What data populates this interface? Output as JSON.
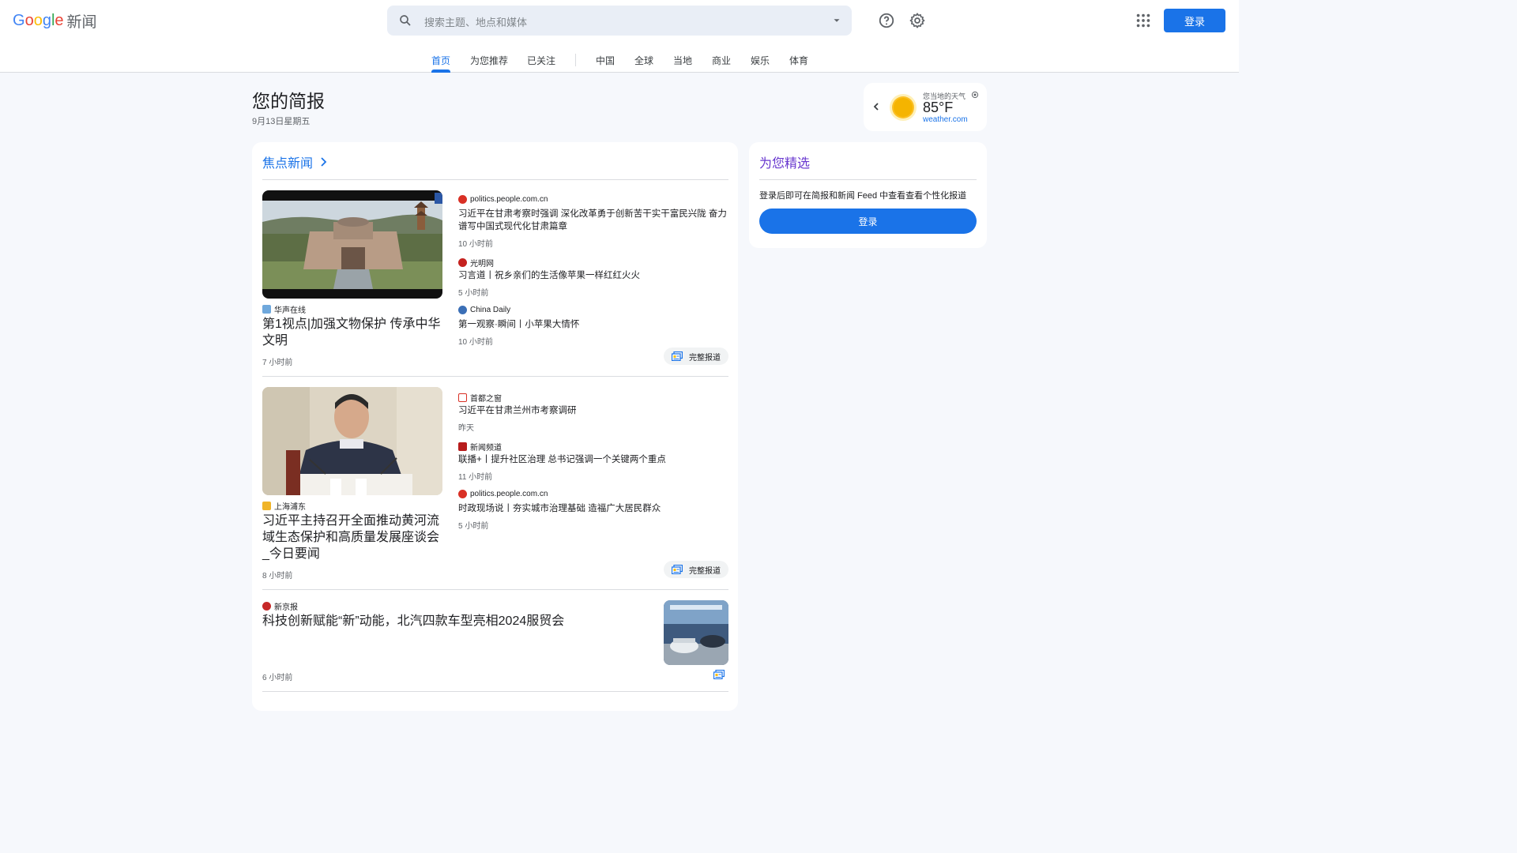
{
  "header": {
    "logo_letters": [
      "G",
      "o",
      "o",
      "g",
      "l",
      "e"
    ],
    "logo_colors": [
      "#4285f4",
      "#ea4335",
      "#fbbc05",
      "#4285f4",
      "#34a853",
      "#ea4335"
    ],
    "product": "新闻",
    "search_placeholder": "搜索主题、地点和媒体",
    "signin": "登录"
  },
  "nav": {
    "tabs": [
      "首页",
      "为您推荐",
      "已关注",
      "中国",
      "全球",
      "当地",
      "商业",
      "娱乐",
      "体育"
    ],
    "active": "首页"
  },
  "briefing": {
    "title": "您的简报",
    "date": "9月13日星期五"
  },
  "weather": {
    "label": "您当地的天气",
    "temp": "85°F",
    "source": "weather.com"
  },
  "top_stories": {
    "title": "焦点新闻",
    "full_coverage": "完整报道",
    "clusters": [
      {
        "main": {
          "source": "华声在线",
          "title": "第1视点|加强文物保护 传承中华文明",
          "time": "7 小时前"
        },
        "related": [
          {
            "source": "politics.people.com.cn",
            "title": "习近平在甘肃考察时强调 深化改革勇于创新苦干实干富民兴陇 奋力谱写中国式现代化甘肃篇章",
            "time": "10 小时前"
          },
          {
            "source": "光明网",
            "title": "习言道丨祝乡亲们的生活像苹果一样红红火火",
            "time": "5 小时前"
          },
          {
            "source": "China Daily",
            "title": "第一观察·瞬间丨小苹果大情怀",
            "time": "10 小时前"
          }
        ]
      },
      {
        "main": {
          "source": "上海浦东",
          "title": "习近平主持召开全面推动黄河流域生态保护和高质量发展座谈会_今日要闻",
          "time": "8 小时前"
        },
        "related": [
          {
            "source": "首都之窗",
            "title": "习近平在甘肃兰州市考察调研",
            "time": "昨天"
          },
          {
            "source": "新闻频道",
            "title": "联播+丨提升社区治理 总书记强调一个关键两个重点",
            "time": "11 小时前"
          },
          {
            "source": "politics.people.com.cn",
            "title": "时政现场说丨夯实城市治理基础 造福广大居民群众",
            "time": "5 小时前"
          }
        ]
      }
    ],
    "single": {
      "source": "新京报",
      "title": "科技创新赋能“新”动能，北汽四款车型亮相2024服贸会",
      "time": "6 小时前"
    }
  },
  "picks": {
    "title": "为您精选",
    "message": "登录后即可在简报和新闻 Feed 中查看查看个性化报道",
    "signin": "登录"
  },
  "colors": {
    "accent": "#1a73e8",
    "picks_title": "#6837cf"
  }
}
